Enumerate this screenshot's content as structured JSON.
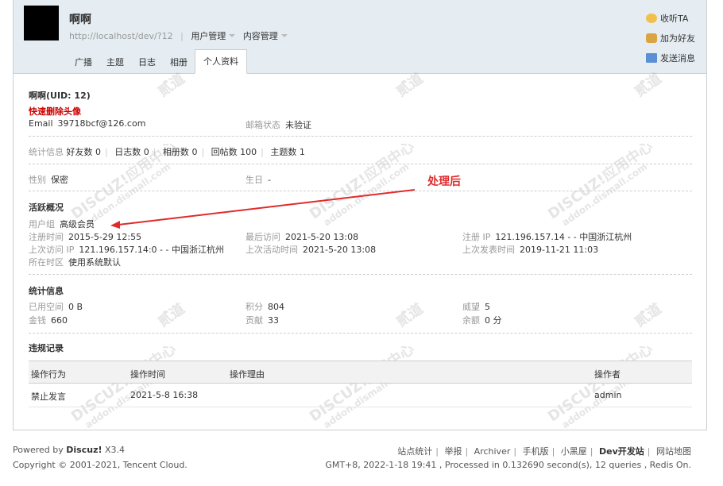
{
  "header": {
    "username": "啊啊",
    "url": "http://localhost/dev/?12",
    "menu_user": "用户管理",
    "menu_content": "内容管理",
    "tabs": [
      "广播",
      "主题",
      "日志",
      "相册",
      "个人资料"
    ],
    "active_tab": "个人资料",
    "actions": {
      "follow": "收听TA",
      "add_friend": "加为好友",
      "send_message": "发送消息"
    }
  },
  "profile": {
    "uid_line": "啊啊(UID: 12)",
    "delete_avatar": "快速删除头像",
    "email_label": "Email",
    "email": "39718bcf@126.com",
    "email_status_label": "邮箱状态",
    "email_status": "未验证",
    "stats_label": "统计信息",
    "stats": [
      {
        "label": "好友数",
        "value": "0"
      },
      {
        "label": "日志数",
        "value": "0"
      },
      {
        "label": "相册数",
        "value": "0"
      },
      {
        "label": "回帖数",
        "value": "100"
      },
      {
        "label": "主题数",
        "value": "1"
      }
    ],
    "gender_label": "性别",
    "gender": "保密",
    "birthday_label": "生日",
    "birthday": "-"
  },
  "activity": {
    "title": "活跃概况",
    "group_label": "用户组",
    "group": "高级会员",
    "reg_time_label": "注册时间",
    "reg_time": "2015-5-29 12:55",
    "last_visit_label": "最后访问",
    "last_visit": "2021-5-20 13:08",
    "reg_ip_label": "注册 IP",
    "reg_ip": "121.196.157.14 - - 中国浙江杭州",
    "last_ip_label": "上次访问 IP",
    "last_ip": "121.196.157.14:0 - - 中国浙江杭州",
    "last_active_label": "上次活动时间",
    "last_active": "2021-5-20 13:08",
    "last_post_label": "上次发表时间",
    "last_post": "2019-11-21 11:03",
    "timezone_label": "所在时区",
    "timezone": "使用系统默认"
  },
  "statistics": {
    "title": "统计信息",
    "space_label": "已用空间",
    "space": "0 B",
    "credits_label": "积分",
    "credits": "804",
    "prestige_label": "威望",
    "prestige": "5",
    "money_label": "金钱",
    "money": "660",
    "contrib_label": "贡献",
    "contrib": "33",
    "balance_label": "余额",
    "balance": "0 分"
  },
  "violations": {
    "title": "违规记录",
    "columns": [
      "操作行为",
      "操作时间",
      "操作理由",
      "操作者"
    ],
    "rows": [
      {
        "action": "禁止发言",
        "time": "2021-5-8 16:38",
        "reason": "",
        "operator": "admin"
      }
    ]
  },
  "annotation": "处理后",
  "watermark": {
    "brand": "DISCUZ!应用中心",
    "site": "addon.dismall.com",
    "name": "贰道"
  },
  "footer": {
    "powered_prefix": "Powered by",
    "powered_brand": "Discuz!",
    "version": "X3.4",
    "copyright": "Copyright © 2001-2021, Tencent Cloud.",
    "links": [
      "站点统计",
      "举报",
      "Archiver",
      "手机版",
      "小黑屋",
      "Dev开发站",
      "网站地图"
    ],
    "status": "GMT+8, 2022-1-18 19:41 , Processed in 0.132690 second(s), 12 queries , Redis On."
  }
}
